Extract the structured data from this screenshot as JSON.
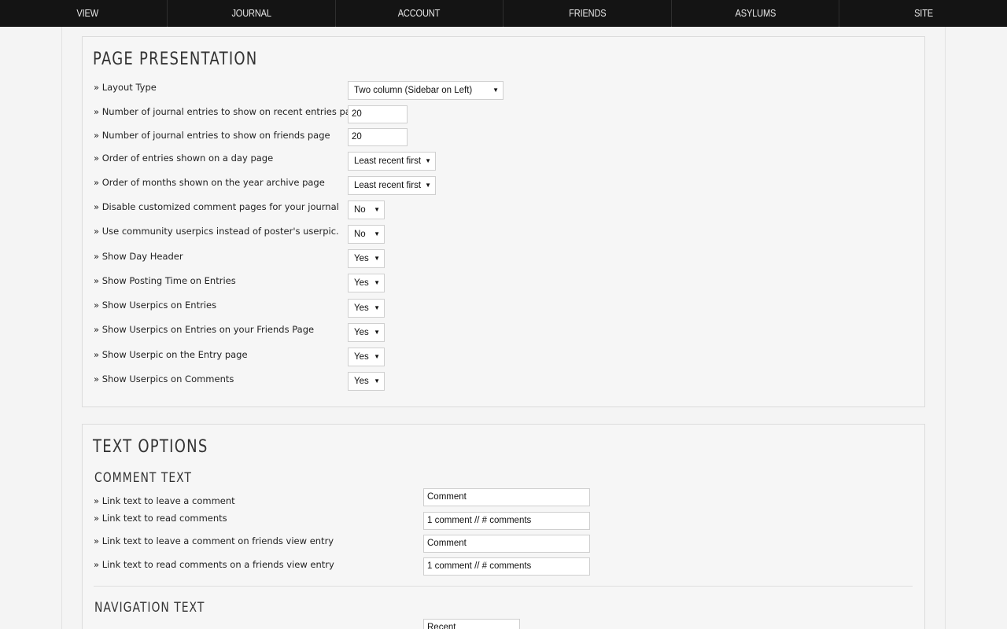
{
  "topnav": {
    "items": [
      {
        "label": "VIEW"
      },
      {
        "label": "JOURNAL"
      },
      {
        "label": "ACCOUNT"
      },
      {
        "label": "FRIENDS"
      },
      {
        "label": "ASYLUMS"
      },
      {
        "label": "SITE"
      }
    ]
  },
  "page_presentation": {
    "title": "PAGE PRESENTATION",
    "rows": [
      {
        "label": "» Layout Type",
        "value": "Two column (Sidebar on Left)"
      },
      {
        "label": "» Number of journal entries to show on recent entries page",
        "value": "20"
      },
      {
        "label": "» Number of journal entries to show on friends page",
        "value": "20"
      },
      {
        "label": "» Order of entries shown on a day page",
        "value": "Least recent first"
      },
      {
        "label": "» Order of months shown on the year archive page",
        "value": "Least recent first"
      },
      {
        "label": "» Disable customized comment pages for your journal",
        "value": "No"
      },
      {
        "label": "» Use community userpics instead of poster's userpic.",
        "value": "No"
      },
      {
        "label": "» Show Day Header",
        "value": "Yes"
      },
      {
        "label": "» Show Posting Time on Entries",
        "value": "Yes"
      },
      {
        "label": "» Show Userpics on Entries",
        "value": "Yes"
      },
      {
        "label": "» Show Userpics on Entries on your Friends Page",
        "value": "Yes"
      },
      {
        "label": "» Show Userpic on the Entry page",
        "value": "Yes"
      },
      {
        "label": "» Show Userpics on Comments",
        "value": "Yes"
      }
    ],
    "arrow": "▼"
  },
  "text_options": {
    "title": "TEXT OPTIONS",
    "comment_text": {
      "title": "COMMENT TEXT",
      "rows": [
        {
          "label": "» Link text to leave a comment",
          "value": "Comment"
        },
        {
          "label": "» Link text to read comments",
          "value": "1 comment // # comments"
        },
        {
          "label": "» Link text to leave a comment on friends view entry",
          "value": "Comment"
        },
        {
          "label": "» Link text to read comments on a friends view entry",
          "value": "1 comment // # comments"
        }
      ]
    },
    "navigation_text": {
      "title": "NAVIGATION TEXT",
      "first_value": "Recent"
    }
  }
}
